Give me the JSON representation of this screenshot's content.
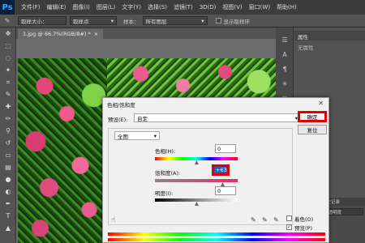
{
  "app": {
    "logo": "Ps"
  },
  "menu": [
    "文件(F)",
    "编辑(E)",
    "图像(I)",
    "图层(L)",
    "文字(Y)",
    "选择(S)",
    "滤镜(T)",
    "3D(D)",
    "视图(V)",
    "窗口(W)",
    "帮助(H)"
  ],
  "options": {
    "sample_size_value": "取样大小：",
    "sample_point": "取样点",
    "sample_label": "样本：",
    "sample_value": "所有图层",
    "show_ring": "显示取样环"
  },
  "document": {
    "tab_title": "1.jpg @ 66.7%(RGB/8#) *",
    "close": "×"
  },
  "properties": {
    "tab": "属性",
    "subtitle": "无属性"
  },
  "lower_panel": {
    "tab": "历史记录",
    "select": "不透明度"
  },
  "dialog": {
    "title": "色相/饱和度",
    "preset_label": "预设(E):",
    "preset_value": "自定",
    "ok_label": "确定",
    "preview_label": "复位",
    "channel_value": "全图",
    "hue_label": "色相(H):",
    "hue_value": "0",
    "saturation_label": "饱和度(A):",
    "saturation_value": "+63",
    "lightness_label": "明度(I):",
    "lightness_value": "0",
    "colorize_label": "着色(O)",
    "preview_check_label": "预览(P)",
    "preview_checked": "✓"
  },
  "colors": {
    "accent_red": "#e00000",
    "dialog_bg": "#f0f0f0",
    "app_bg": "#535353"
  }
}
